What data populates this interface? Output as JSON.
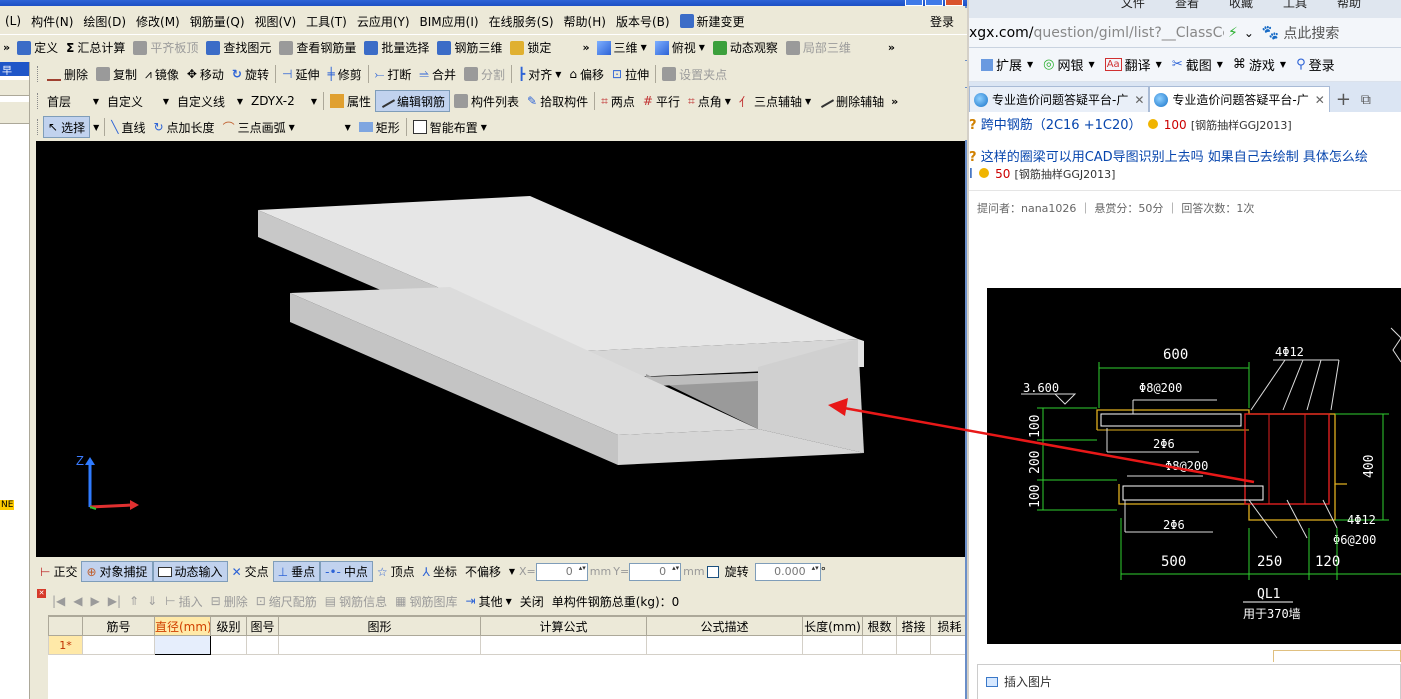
{
  "menubar": {
    "items": [
      "(L)",
      "构件(N)",
      "绘图(D)",
      "修改(M)",
      "钢筋量(Q)",
      "视图(V)",
      "工具(T)",
      "云应用(Y)",
      "BIM应用(I)",
      "在线服务(S)",
      "帮助(H)",
      "版本号(B)"
    ],
    "new_change": "新建变更",
    "login": "登录"
  },
  "row1": {
    "define": "定义",
    "sum": "汇总计算",
    "flat_roof": "平齐板顶",
    "find": "查找图元",
    "view_rebar": "查看钢筋量",
    "batch_select": "批量选择",
    "rebar_3d": "钢筋三维",
    "lock": "锁定",
    "view3d": "三维",
    "topview": "俯视",
    "dynamic": "动态观察",
    "partial3d": "局部三维"
  },
  "row2": {
    "delete": "删除",
    "copy": "复制",
    "mirror": "镜像",
    "move": "移动",
    "rotate": "旋转",
    "extend": "延伸",
    "trim": "修剪",
    "break": "打断",
    "merge": "合并",
    "split": "分割",
    "align": "对齐",
    "offset": "偏移",
    "stretch": "拉伸",
    "set_grip": "设置夹点"
  },
  "row3": {
    "floor": "首层",
    "custom": "自定义",
    "custom_line": "自定义线",
    "code": "ZDYX-2",
    "property": "属性",
    "edit_rebar": "编辑钢筋",
    "comp_list": "构件列表",
    "pick": "拾取构件",
    "two_pts": "两点",
    "parallel": "平行",
    "pt_angle": "点角",
    "three_pt_aux": "三点辅轴",
    "del_aux": "删除辅轴"
  },
  "row4": {
    "select": "选择",
    "line": "直线",
    "pt_len": "点加长度",
    "arc3": "三点画弧",
    "rect": "矩形",
    "smart": "智能布置"
  },
  "left_strip": {
    "tag": "NE",
    "head": "早"
  },
  "snapbar": {
    "ortho": "正交",
    "osnap": "对象捕捉",
    "dyn_input": "动态输入",
    "intersect": "交点",
    "perp": "垂点",
    "mid": "中点",
    "vertex": "顶点",
    "coord": "坐标",
    "no_offset": "不偏移",
    "x_label": "X=",
    "x_val": "0",
    "mm1": "mm",
    "y_label": "Y=",
    "y_val": "0",
    "mm2": "mm",
    "rotate": "旋转",
    "rot_val": "0.000",
    "deg": "°"
  },
  "rebarbar": {
    "insert": "插入",
    "delete": "删除",
    "scale": "缩尺配筋",
    "info": "钢筋信息",
    "lib": "钢筋图库",
    "other": "其他",
    "close": "关闭",
    "total": "单构件钢筋总重(kg)：0"
  },
  "grid": {
    "headers": [
      "",
      "筋号",
      "直径(mm)",
      "级别",
      "图号",
      "图形",
      "计算公式",
      "公式描述",
      "长度(mm)",
      "根数",
      "搭接",
      "损耗"
    ],
    "row1": "1*"
  },
  "browser": {
    "menus": [
      "文件",
      "查看",
      "收藏",
      "工具",
      "帮助"
    ],
    "url_main": "xgx.com/",
    "url_rest": "question/giml/list?__ClassCc",
    "search": "点此搜索",
    "ext": {
      "expand": "扩展",
      "bank": "网银",
      "translate": "翻译",
      "screenshot": "截图",
      "games": "游戏",
      "login": "登录"
    },
    "tab1": "专业造价问题答疑平台-广",
    "tab2": "专业造价问题答疑平台-广",
    "q1_title": "跨中钢筋（2C16 +1C20）",
    "q1_pts": "100",
    "q1_tag": "[钢筋抽样GGJ2013]",
    "q2_title": "这样的圈梁可以用CAD导图识别上去吗 如果自己去绘制 具体怎么绘",
    "q2_pts": "50",
    "q2_tag": "[钢筋抽样GGJ2013]",
    "meta": "提问者：nana1026  ｜  悬赏分：50分  ｜  回答次数：1次",
    "insert_image": "插入图片"
  },
  "cad": {
    "d600": "600",
    "r4phi12_top": "4Φ12",
    "elev": "3.600",
    "s1": "Φ8@200",
    "s2": "2Φ6",
    "s3": "Φ8@200",
    "s4": "2Φ6",
    "h100a": "100",
    "h200": "200",
    "h100b": "100",
    "h400": "400",
    "r4phi12_bot": "4Φ12",
    "s5": "Φ6@200",
    "w500": "500",
    "w250": "250",
    "w120": "120",
    "ql": "QL1",
    "note": "用于370墙"
  }
}
